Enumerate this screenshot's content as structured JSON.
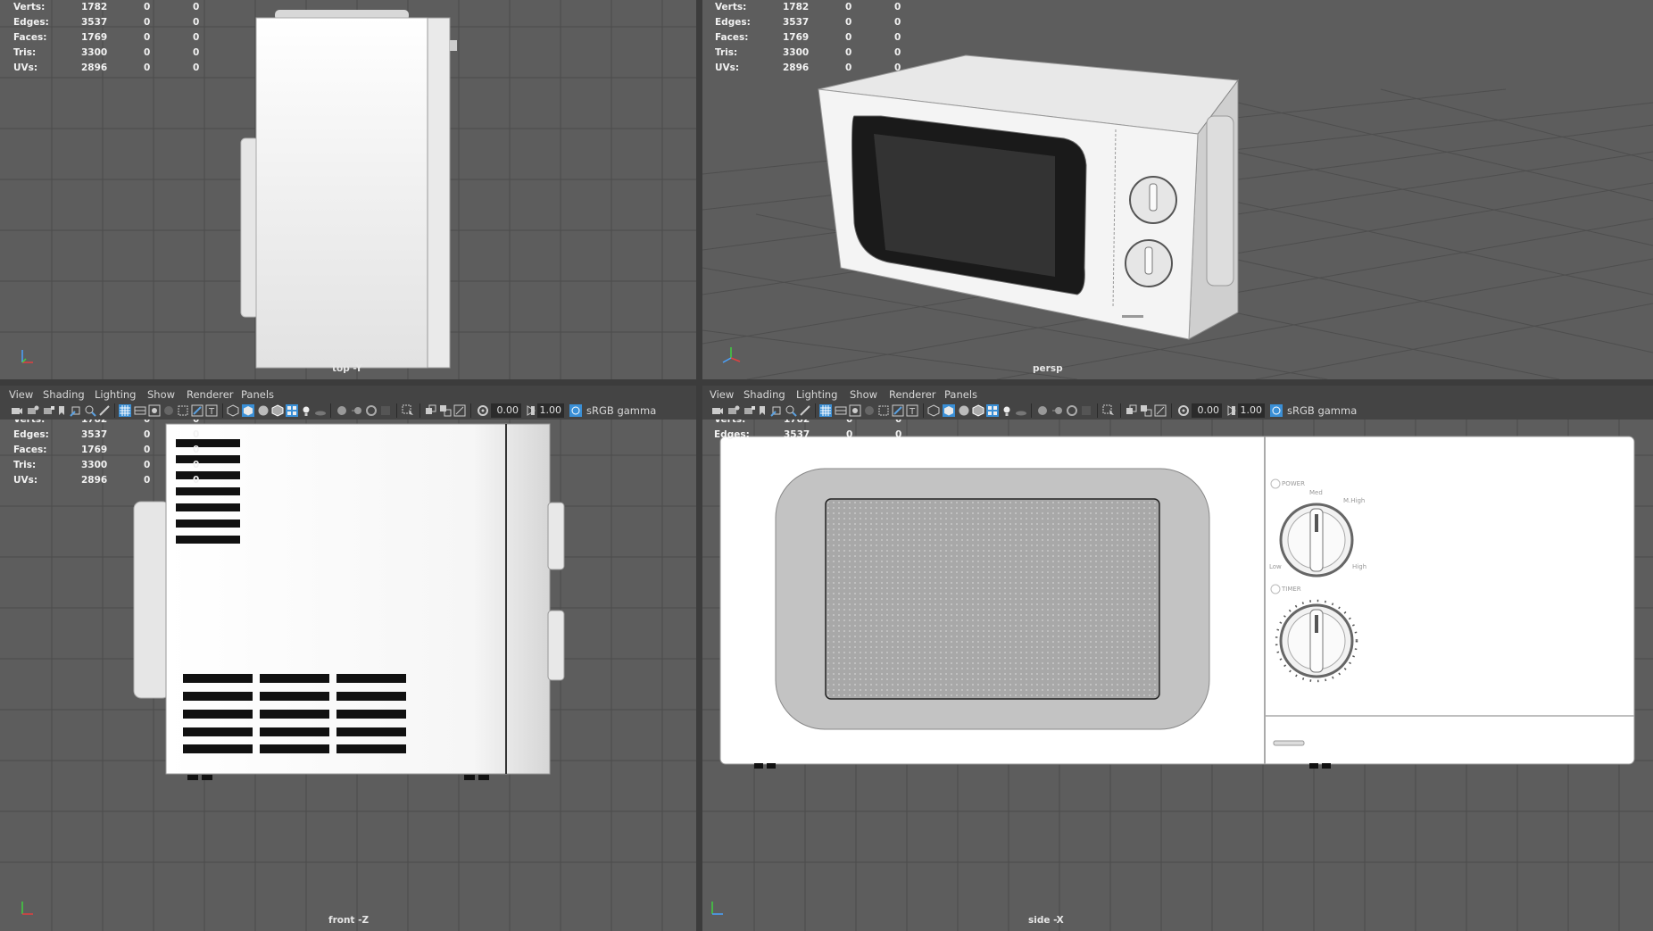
{
  "stats": {
    "labels": [
      "Verts:",
      "Edges:",
      "Faces:",
      "Tris:",
      "UVs:"
    ],
    "values": [
      [
        "1782",
        "0",
        "0"
      ],
      [
        "3537",
        "0",
        "0"
      ],
      [
        "1769",
        "0",
        "0"
      ],
      [
        "3300",
        "0",
        "0"
      ],
      [
        "2896",
        "0",
        "0"
      ]
    ]
  },
  "viewports": {
    "top": {
      "label": "top -Y"
    },
    "persp": {
      "label": "persp"
    },
    "front": {
      "label": "front -Z"
    },
    "side": {
      "label": "side -X"
    }
  },
  "menus": [
    "View",
    "Shading",
    "Lighting",
    "Show",
    "Renderer",
    "Panels"
  ],
  "toolbar": {
    "exposure": "0.00",
    "gamma": "1.00",
    "color_space": "sRGB gamma"
  },
  "model": {
    "dial_labels": {
      "power": "POWER",
      "med": "Med",
      "mhigh": "M.High",
      "low": "Low",
      "high": "High",
      "timer": "TIMER"
    }
  },
  "colors": {
    "viewport_bg": "#5d5d5d",
    "grid_line": "#4a4a4a",
    "ui_bg": "#444444",
    "active_icon": "#3a8fd6"
  }
}
